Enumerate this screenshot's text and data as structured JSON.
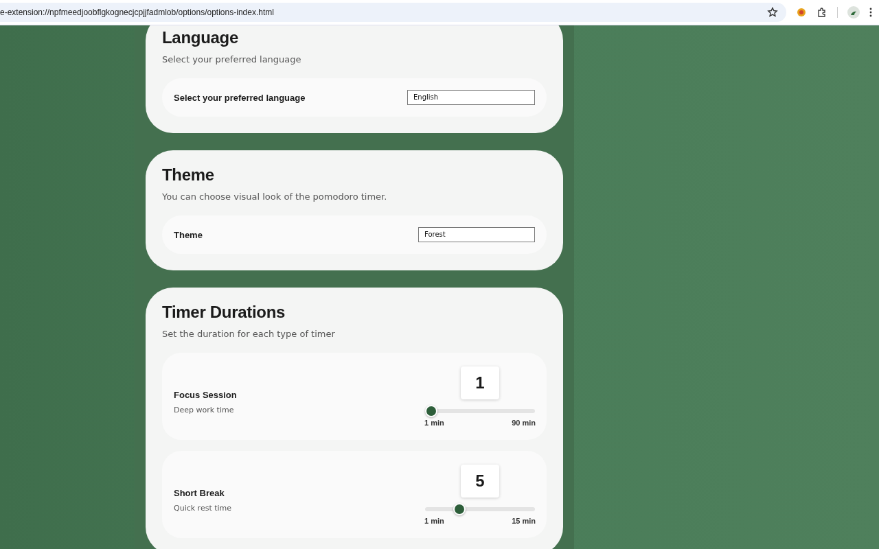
{
  "browser": {
    "url": "e-extension://npfmeedjoobflgkognecjcpjjfadmlob/options/options-index.html"
  },
  "sections": [
    {
      "kind": "select",
      "title": "Language",
      "description": "Select your preferred language",
      "label": "Select your preferred language",
      "value": "English"
    },
    {
      "kind": "select",
      "title": "Theme",
      "description": "You can choose visual look of the pomodoro timer.",
      "label": "Theme",
      "value": "Forest"
    },
    {
      "kind": "sliders",
      "title": "Timer Durations",
      "description": "Set the duration for each type of timer",
      "rows": [
        {
          "label": "Focus Session",
          "hint": "Deep work time",
          "value": "1",
          "level": 0,
          "min": "1 min",
          "max": "90 min"
        },
        {
          "label": "Short Break",
          "hint": "Quick rest time",
          "value": "5",
          "level": 0.286,
          "min": "1 min",
          "max": "15 min"
        }
      ]
    }
  ]
}
